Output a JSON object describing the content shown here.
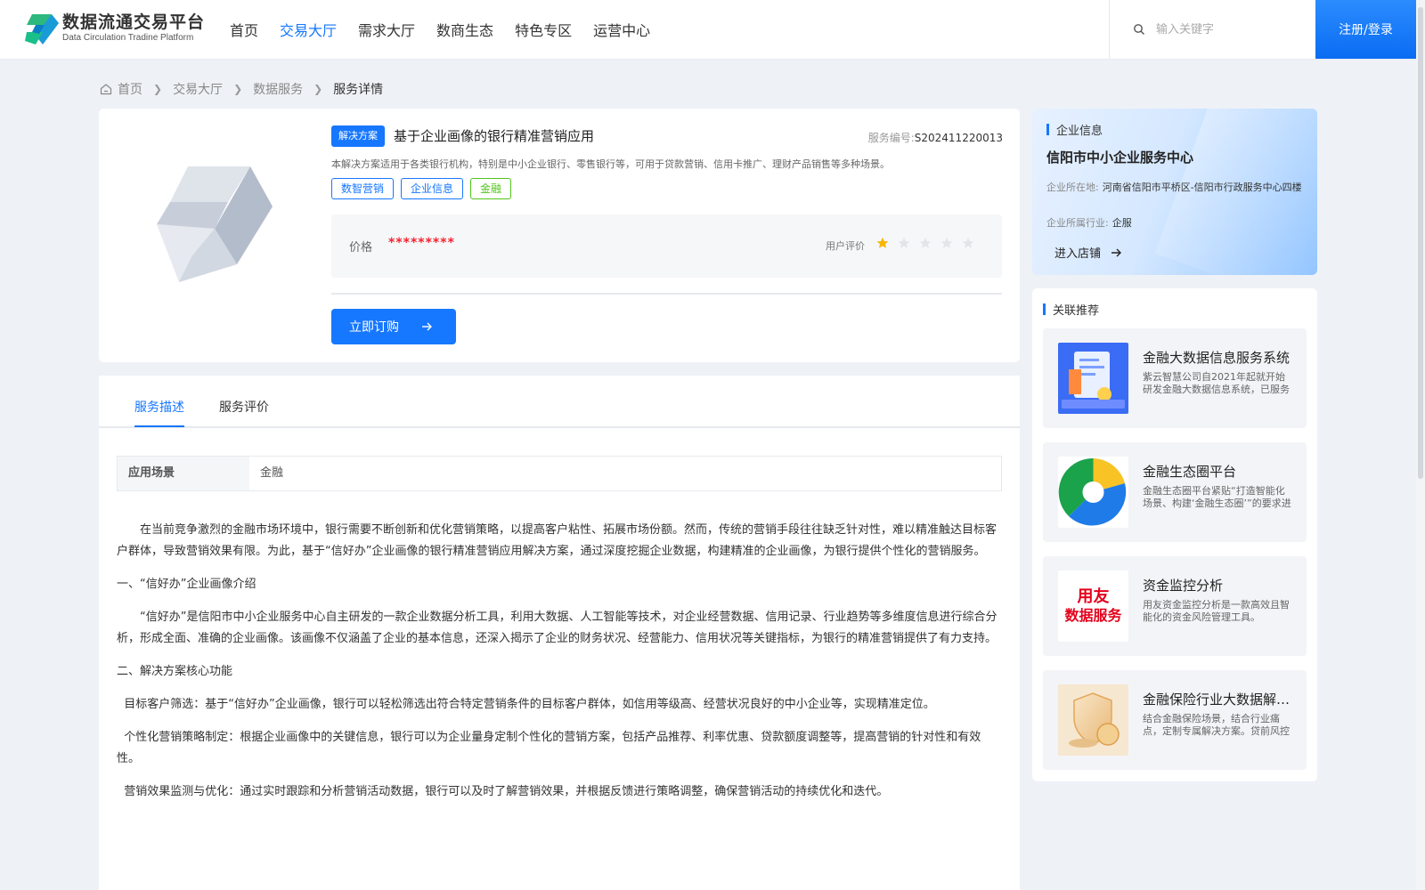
{
  "header": {
    "logo_title": "数据流通交易平台",
    "logo_subtitle": "Data Circulation Tradine Platform",
    "nav": [
      "首页",
      "交易大厅",
      "需求大厅",
      "数商生态",
      "特色专区",
      "运营中心"
    ],
    "active_nav": "交易大厅",
    "search_placeholder": "输入关键字",
    "login_label": "注册/登录"
  },
  "breadcrumb": [
    "首页",
    "交易大厅",
    "数据服务",
    "服务详情"
  ],
  "product": {
    "badge": "解决方案",
    "title": "基于企业画像的银行精准营销应用",
    "service_id_label": "服务编号:",
    "service_id": "S202411220013",
    "description": "本解决方案适用于各类银行机构，特别是中小企业银行、零售银行等，可用于贷款营销、信用卡推广、理财产品销售等多种场景。",
    "tags": [
      "数智营销",
      "企业信息",
      "金融"
    ],
    "price_label": "价格",
    "price_value": "*********",
    "rating_label": "用户评价",
    "rating": 1,
    "rating_max": 5,
    "order_label": "立即订购"
  },
  "tabs": [
    "服务描述",
    "服务评价"
  ],
  "scene": {
    "key": "应用场景",
    "value": "金融"
  },
  "article": [
    "　　在当前竞争激烈的金融市场环境中，银行需要不断创新和优化营销策略，以提高客户粘性、拓展市场份额。然而，传统的营销手段往往缺乏针对性，难以精准触达目标客户群体，导致营销效果有限。为此，基于“信好办”企业画像的银行精准营销应用解决方案，通过深度挖掘企业数据，构建精准的企业画像，为银行提供个性化的营销服务。",
    "一、“信好办”企业画像介绍",
    "　　“信好办”是信阳市中小企业服务中心自主研发的一款企业数据分析工具，利用大数据、人工智能等技术，对企业经营数据、信用记录、行业趋势等多维度信息进行综合分析，形成全面、准确的企业画像。该画像不仅涵盖了企业的基本信息，还深入揭示了企业的财务状况、经营能力、信用状况等关键指标，为银行的精准营销提供了有力支持。",
    "二、解决方案核心功能",
    "  目标客户筛选：基于“信好办”企业画像，银行可以轻松筛选出符合特定营销条件的目标客户群体，如信用等级高、经营状况良好的中小企业等，实现精准定位。",
    "  个性化营销策略制定：根据企业画像中的关键信息，银行可以为企业量身定制个性化的营销方案，包括产品推荐、利率优惠、贷款额度调整等，提高营销的针对性和有效性。",
    "  营销效果监测与优化：通过实时跟踪和分析营销活动数据，银行可以及时了解营销效果，并根据反馈进行策略调整，确保营销活动的持续优化和迭代。"
  ],
  "company": {
    "section_title": "企业信息",
    "name": "信阳市中小企业服务中心",
    "location_label": "企业所在地:",
    "location": "河南省信阳市平桥区-信阳市行政服务中心四楼",
    "industry_label": "企业所属行业:",
    "industry": "企服",
    "enter_label": "进入店铺"
  },
  "related": {
    "section_title": "关联推荐",
    "items": [
      {
        "title": "金融大数据信息服务系统",
        "desc": "紫云智慧公司自2021年起就开始研发金融大数据信息系统，已服务多家金融机构。"
      },
      {
        "title": "金融生态圈平台",
        "desc": "金融生态圈平台紧贴“打造智能化场景、构建‘金融生态圈’”的要求进行建设。"
      },
      {
        "title": "资金监控分析",
        "desc": "用友资金监控分析是一款高效且智能化的资金风险管理工具。",
        "logo_line1": "用友",
        "logo_line2": "数据服务"
      },
      {
        "title": "金融保险行业大数据解决方案",
        "desc": "结合金融保险场景，结合行业痛点，定制专属解决方案。贷前风控等。"
      }
    ]
  },
  "colors": {
    "primary": "#1677ff",
    "tag_green": "#52c41a",
    "price_red": "#f5222d",
    "star_gold": "#f5b70a"
  }
}
